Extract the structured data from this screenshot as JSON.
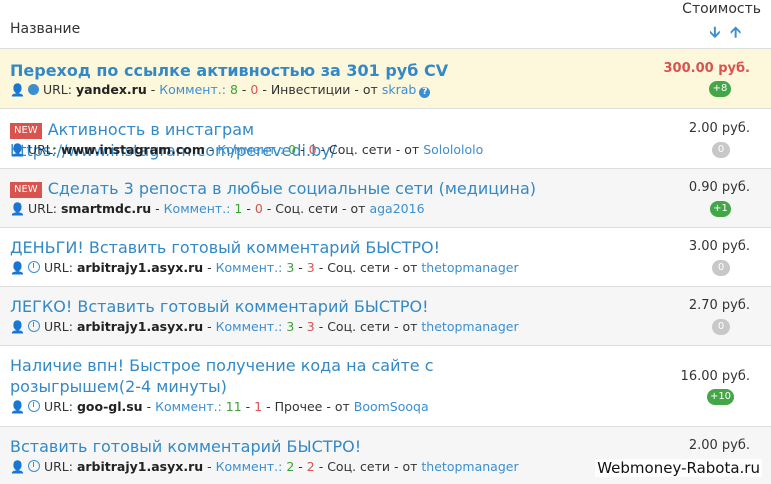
{
  "header": {
    "name_label": "Название",
    "cost_label": "Стоимость",
    "sort_desc": "🡫",
    "sort_asc": "🡩"
  },
  "rows": [
    {
      "title": "Переход по ссылке активностью за 301 руб CV",
      "new_badge": "",
      "url_label": "URL:",
      "domain": "yandex.ru",
      "sep1": "-",
      "comments_label": "Коммент.:",
      "pos": "8",
      "dash": "-",
      "neg": "0",
      "sep2": "-",
      "category": "Инвестиции",
      "sep3": "- от",
      "author": "skrab",
      "price": "300.00 руб.",
      "bonus": "+8"
    },
    {
      "title": "Активность в инстаграм https://www.instagram.com/perevedi.by/",
      "new_badge": "NEW",
      "url_label": "URL:",
      "domain": "www.instagram.com",
      "sep1": "-",
      "comments_label": "Коммент.:",
      "pos": "0",
      "dash": "-",
      "neg": "0",
      "sep2": "-",
      "category": "Соц. сети",
      "sep3": "- от",
      "author": "Sololololo",
      "price": "2.00 руб.",
      "bonus": "0"
    },
    {
      "title": "Сделать 3 репоста в любые социальные сети (медицина)",
      "new_badge": "NEW",
      "url_label": "URL:",
      "domain": "smartmdc.ru",
      "sep1": "-",
      "comments_label": "Коммент.:",
      "pos": "1",
      "dash": "-",
      "neg": "0",
      "sep2": "-",
      "category": "Соц. сети",
      "sep3": "- от",
      "author": "aga2016",
      "price": "0.90 руб.",
      "bonus": "+1"
    },
    {
      "title": "ДЕНЬГИ! Вставить готовый комментарий БЫСТРО!",
      "new_badge": "",
      "url_label": "URL:",
      "domain": "arbitrajy1.asyx.ru",
      "sep1": "-",
      "comments_label": "Коммент.:",
      "pos": "3",
      "dash": "-",
      "neg": "3",
      "sep2": "-",
      "category": "Соц. сети",
      "sep3": "- от",
      "author": "thetopmanager",
      "price": "3.00 руб.",
      "bonus": "0"
    },
    {
      "title": "ЛЕГКО! Вставить готовый комментарий БЫСТРО!",
      "new_badge": "",
      "url_label": "URL:",
      "domain": "arbitrajy1.asyx.ru",
      "sep1": "-",
      "comments_label": "Коммент.:",
      "pos": "3",
      "dash": "-",
      "neg": "3",
      "sep2": "-",
      "category": "Соц. сети",
      "sep3": "- от",
      "author": "thetopmanager",
      "price": "2.70 руб.",
      "bonus": "0"
    },
    {
      "title": "Наличие впн! Быстрое получение кода на сайте с розыгрышем(2-4 минуты)",
      "new_badge": "",
      "url_label": "URL:",
      "domain": "goo-gl.su",
      "sep1": "-",
      "comments_label": "Коммент.:",
      "pos": "11",
      "dash": "-",
      "neg": "1",
      "sep2": "-",
      "category": "Прочее",
      "sep3": "- от",
      "author": "BoomSooqa",
      "price": "16.00 руб.",
      "bonus": "+10"
    },
    {
      "title": "Вставить готовый комментарий БЫСТРО!",
      "new_badge": "",
      "url_label": "URL:",
      "domain": "arbitrajy1.asyx.ru",
      "sep1": "-",
      "comments_label": "Коммент.:",
      "pos": "2",
      "dash": "-",
      "neg": "2",
      "sep2": "-",
      "category": "Соц. сети",
      "sep3": "- от",
      "author": "thetopmanager",
      "price": "2.00 руб.",
      "bonus": ""
    }
  ],
  "help_glyph": "?",
  "watermark": "Webmoney-Rabota.ru",
  "colors": {
    "link": "#3389c6",
    "featured_bg": "#fdf8dc",
    "price_hot": "#d9534f",
    "bonus_green": "#43a747",
    "bonus_gray": "#c8c8c8",
    "new_badge": "#d9534f"
  }
}
